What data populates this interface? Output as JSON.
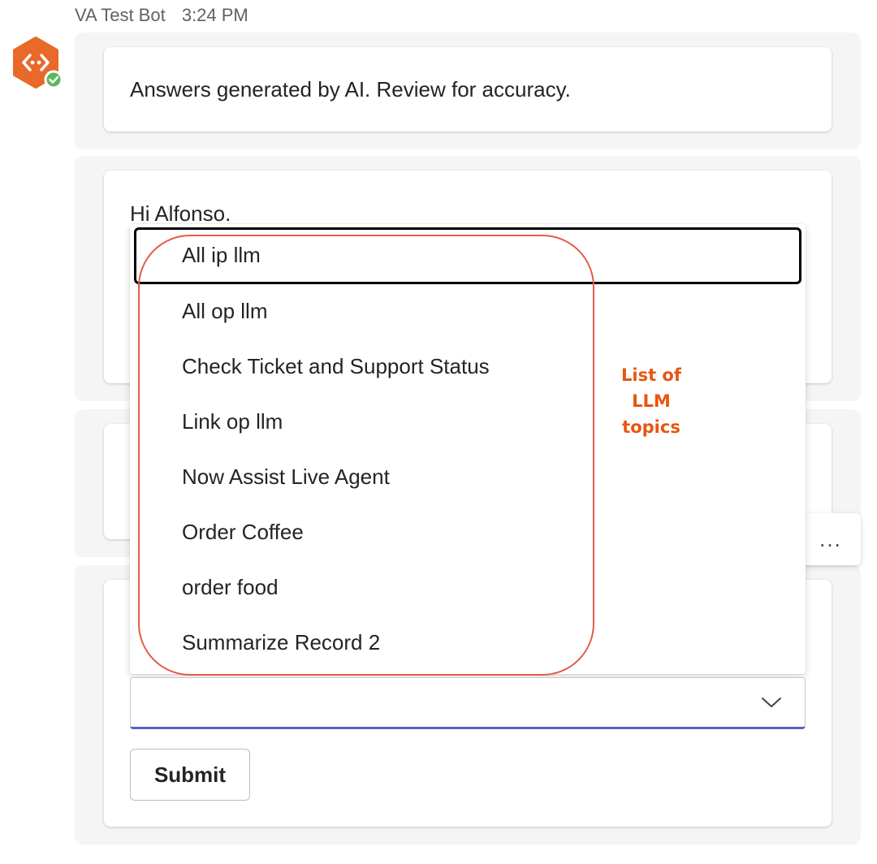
{
  "header": {
    "sender": "VA Test Bot",
    "time": "3:24 PM"
  },
  "messages": {
    "disclaimer": "Answers generated by AI. Review for accuracy.",
    "greeting": "Hi Alfonso."
  },
  "dropdown": {
    "options": [
      "All ip llm",
      "All op llm",
      "Check Ticket and Support Status",
      "Link op llm",
      "Now Assist Live Agent",
      "Order Coffee",
      "order food",
      "Summarize Record 2"
    ],
    "focused_index": 0,
    "selected_value": ""
  },
  "annotation": {
    "line1": "List of LLM",
    "line2": "topics",
    "color": "#e8560f"
  },
  "buttons": {
    "more_label": "...",
    "submit_label": "Submit"
  },
  "colors": {
    "bot_avatar": "#e8692a",
    "online": "#5cb85c",
    "focus_underline": "#5b5fc7"
  },
  "icons": {
    "avatar": "bot-code-icon",
    "status": "online-check-icon",
    "select": "chevron-down-icon"
  }
}
